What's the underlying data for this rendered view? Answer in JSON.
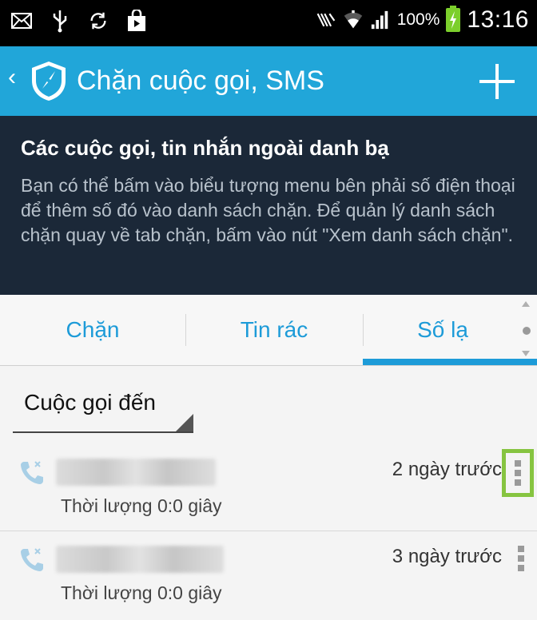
{
  "status_bar": {
    "icons": [
      "mail-icon",
      "usb-icon",
      "sync-icon",
      "shop-icon"
    ],
    "right_icons": [
      "nfc-icon",
      "wifi-icon",
      "signal-icon"
    ],
    "battery_percent": "100%",
    "battery_level": 1.0,
    "time": "13:16"
  },
  "action_bar": {
    "back_glyph": "‹",
    "title": "Chặn cuộc gọi, SMS",
    "color": "#21a6d9"
  },
  "banner": {
    "title": "Các cuộc gọi, tin nhắn ngoài danh bạ",
    "body": "Bạn có thể bấm vào biểu tượng menu bên phải số điện thoại để thêm số đó vào danh sách chặn. Để quản lý danh sách chặn quay về tab chặn, bấm vào nút \"Xem danh sách chặn\"."
  },
  "tabs": [
    {
      "label": "Chặn",
      "selected": false
    },
    {
      "label": "Tin rác",
      "selected": false
    },
    {
      "label": "Số lạ",
      "selected": true
    }
  ],
  "filter": {
    "selected": "Cuộc gọi đến"
  },
  "call_log": [
    {
      "time_ago": "2 ngày trước",
      "duration": "Thời lượng 0:0 giây",
      "menu_highlighted": true
    },
    {
      "time_ago": "3 ngày trước",
      "duration": "Thời lượng 0:0 giây",
      "menu_highlighted": false
    }
  ],
  "accent_color": "#1d9bd8",
  "highlight_color": "#86c440"
}
